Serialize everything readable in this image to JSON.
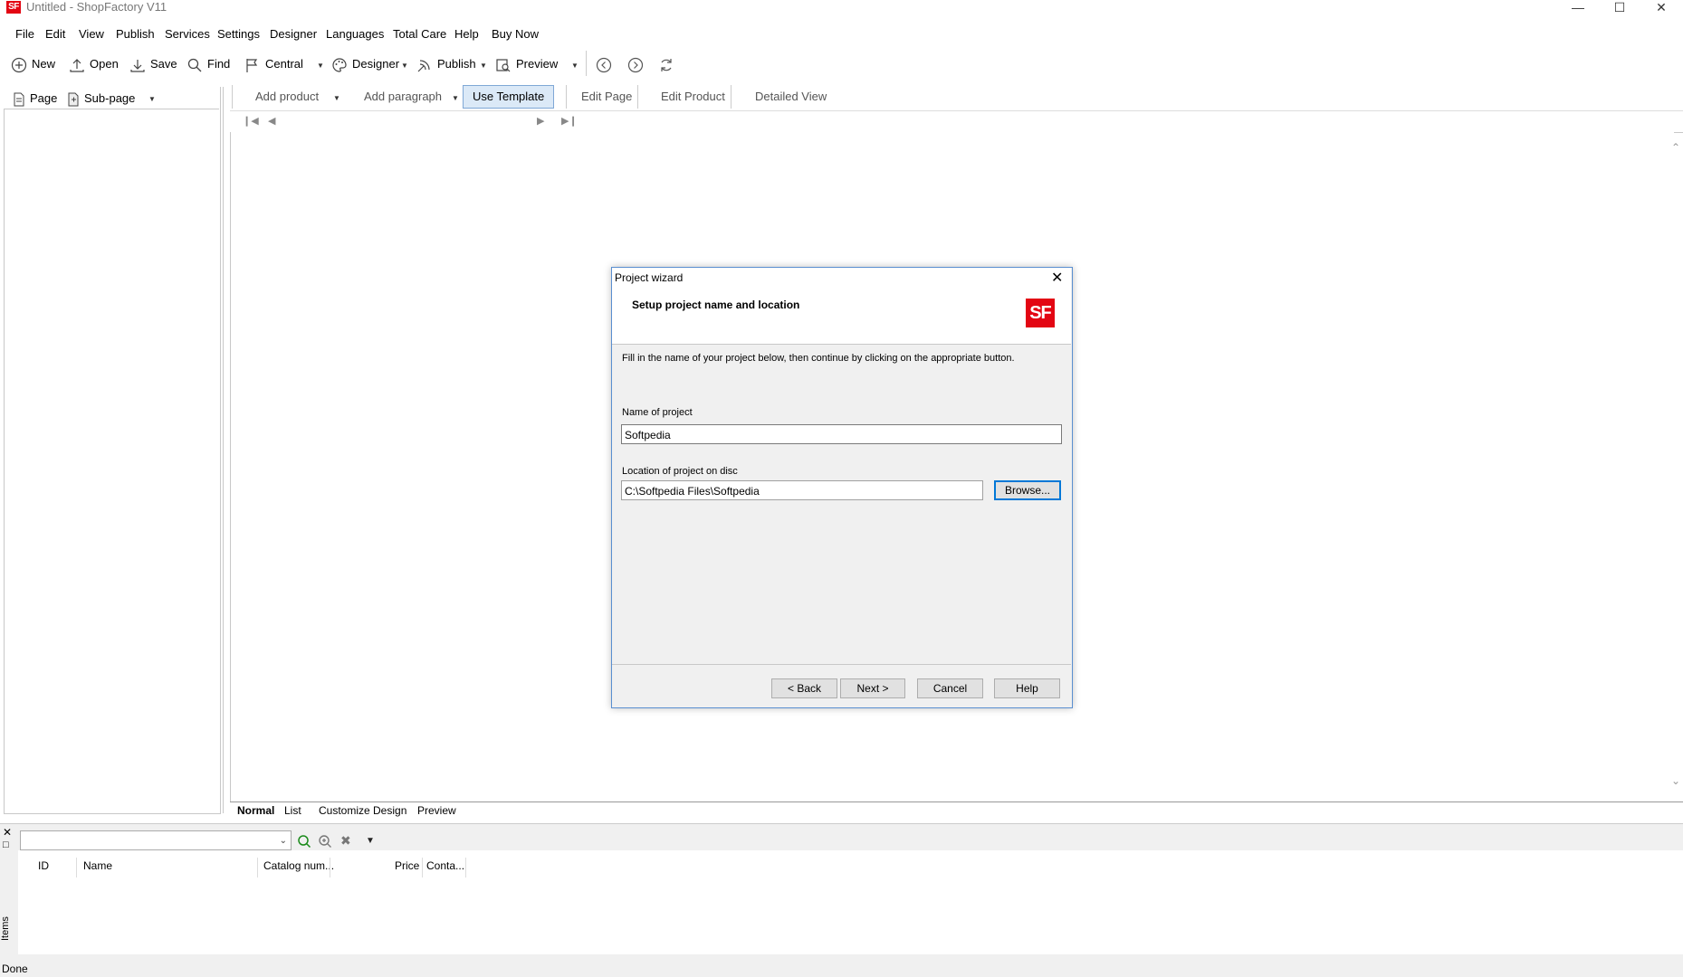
{
  "window": {
    "title": "Untitled - ShopFactory V11",
    "app_icon_text": "SF"
  },
  "menu": [
    "File",
    "Edit",
    "View",
    "Publish",
    "Services",
    "Settings",
    "Designer",
    "Languages",
    "Total Care",
    "Help",
    "Buy Now"
  ],
  "toolbar": {
    "new": "New",
    "open": "Open",
    "save": "Save",
    "find": "Find",
    "central": "Central",
    "designer": "Designer",
    "publish": "Publish",
    "preview": "Preview"
  },
  "left_panel": {
    "page": "Page",
    "subpage": "Sub-page"
  },
  "content_tabs": {
    "add_product": "Add product",
    "add_paragraph": "Add paragraph",
    "use_template": "Use Template",
    "edit_page": "Edit Page",
    "edit_product": "Edit Product",
    "detailed_view": "Detailed View"
  },
  "bottom_tabs": [
    "Normal",
    "List",
    "Customize Design",
    "Preview"
  ],
  "items_panel": {
    "side_label": "Items",
    "columns": [
      "ID",
      "Name",
      "Catalog num...",
      "Price",
      "Conta..."
    ]
  },
  "status": "Done",
  "dialog": {
    "title": "Project wizard",
    "heading": "Setup project name and location",
    "logo_text": "SF",
    "instruction": "Fill in the name of your project below, then continue by clicking on the appropriate button.",
    "name_label": "Name of project",
    "name_value": "Softpedia",
    "location_label": "Location of project on disc",
    "location_value": "C:\\Softpedia Files\\Softpedia",
    "browse": "Browse...",
    "back": "< Back",
    "next": "Next >",
    "cancel": "Cancel",
    "help": "Help"
  },
  "colors": {
    "brand_red": "#e30613",
    "focus_blue": "#0078d7",
    "active_tab_bg": "#dbe9f7"
  }
}
